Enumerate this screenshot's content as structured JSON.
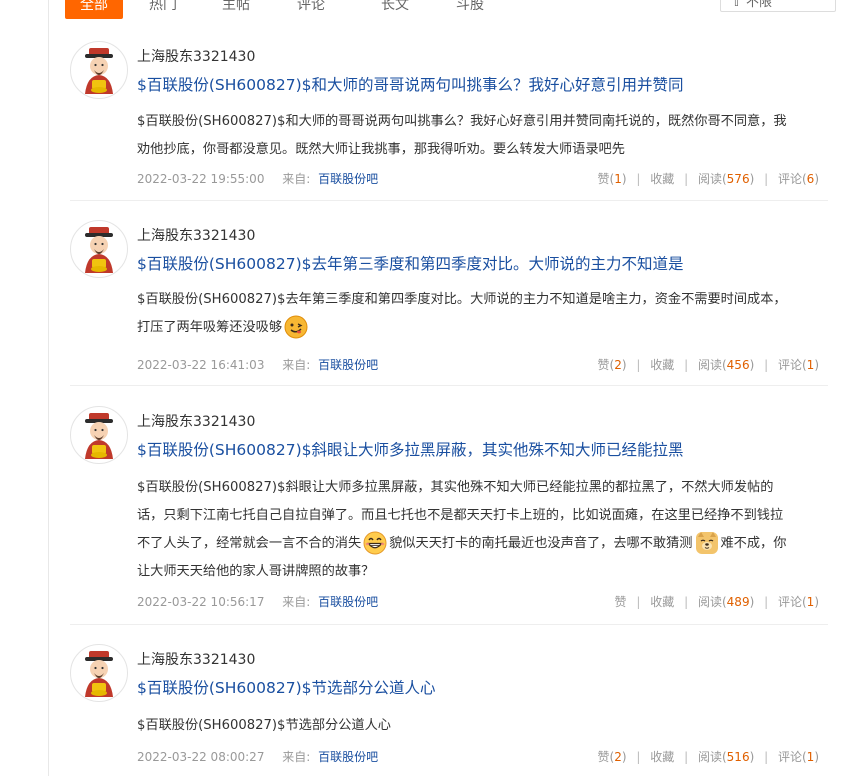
{
  "tabs": [
    "全部",
    "热门",
    "主帖",
    "评论",
    "长文",
    "斗股"
  ],
  "filter": {
    "label": "⇧ 不限"
  },
  "posts": [
    {
      "author": "上海股东3321430",
      "title": "$百联股份(SH600827)$和大师的哥哥说两句叫挑事么？我好心好意引用并赞同",
      "body_lines": [
        "$百联股份(SH600827)$和大师的哥哥说两句叫挑事么？我好心好意引用并赞同南托说的，既然你哥不同意，我",
        "劝他抄底，你哥都没意见。既然大师让我挑事，那我得听劝。要么转发大师语录吧先"
      ],
      "date": "2022-03-22 19:55:00",
      "from_label": "来自:",
      "forum": "百联股份吧",
      "like_label": "赞",
      "like_count": "1",
      "fav_label": "收藏",
      "read_label": "阅读",
      "read_count": "576",
      "comment_label": "评论",
      "comment_count": "6"
    },
    {
      "author": "上海股东3321430",
      "title": "$百联股份(SH600827)$去年第三季度和第四季度对比。大师说的主力不知道是",
      "body_lines": [
        "$百联股份(SH600827)$去年第三季度和第四季度对比。大师说的主力不知道是啥主力，资金不需要时间成本，",
        "打压了两年吸筹还没吸够"
      ],
      "date": "2022-03-22 16:41:03",
      "from_label": "来自:",
      "forum": "百联股份吧",
      "like_label": "赞",
      "like_count": "2",
      "fav_label": "收藏",
      "read_label": "阅读",
      "read_count": "456",
      "comment_label": "评论",
      "comment_count": "1"
    },
    {
      "author": "上海股东3321430",
      "title": "$百联股份(SH600827)$斜眼让大师多拉黑屏蔽，其实他殊不知大师已经能拉黑",
      "body_lines": [
        "$百联股份(SH600827)$斜眼让大师多拉黑屏蔽，其实他殊不知大师已经能拉黑的都拉黑了，不然大师发帖的",
        "话，只剩下江南七托自己自拉自弹了。而且七托也不是都天天打卡上班的，比如说面瘫，在这里已经挣不到钱拉",
        "不了人头了，经常就会一言不合的消失",
        "貌似天天打卡的南托最近也没声音了，去哪不敢猜测",
        "难不成，你",
        "让大师天天给他的家人哥讲牌照的故事？"
      ],
      "date": "2022-03-22 10:56:17",
      "from_label": "来自:",
      "forum": "百联股份吧",
      "like_label": "赞",
      "like_count": "",
      "fav_label": "收藏",
      "read_label": "阅读",
      "read_count": "489",
      "comment_label": "评论",
      "comment_count": "1"
    },
    {
      "author": "上海股东3321430",
      "title": "$百联股份(SH600827)$节选部分公道人心",
      "body_lines": [
        "$百联股份(SH600827)$节选部分公道人心"
      ],
      "date": "2022-03-22 08:00:27",
      "from_label": "来自:",
      "forum": "百联股份吧",
      "like_label": "赞",
      "like_count": "2",
      "fav_label": "收藏",
      "read_label": "阅读",
      "read_count": "516",
      "comment_label": "评论",
      "comment_count": "1"
    }
  ],
  "paren_open": "(",
  "paren_close": ")",
  "divider": "|",
  "colors": {
    "accent": "#ff6600",
    "link": "#1a4fa0",
    "count": "#e06000"
  },
  "icons": [
    "avatar-caishen-icon",
    "emoji-playful-icon",
    "emoji-grin-icon",
    "emoji-doge-icon"
  ]
}
